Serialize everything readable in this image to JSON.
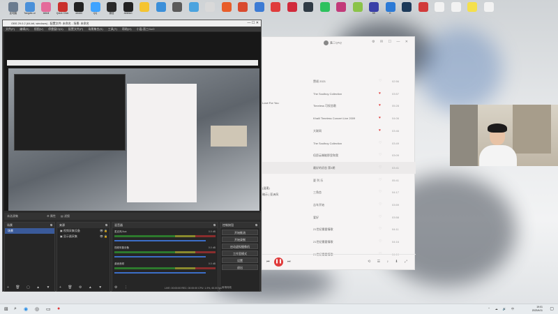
{
  "desktop_icons": [
    {
      "label": "此电脑",
      "color": "#6b7c8f"
    },
    {
      "label": "Tangdtc-ui",
      "color": "#4a90d9"
    },
    {
      "label": "bilibili",
      "color": "#e46b9a"
    },
    {
      "label": "Quick Click",
      "color": "#c9302c"
    },
    {
      "label": "obs64",
      "color": "#222222"
    },
    {
      "label": "QQ",
      "color": "#3ea3ff"
    },
    {
      "label": "微信",
      "color": "#2a2a2a"
    },
    {
      "label": "Ableton",
      "color": "#222222"
    },
    {
      "label": "",
      "color": "#f4c430"
    },
    {
      "label": "",
      "color": "#3b8fd9"
    },
    {
      "label": "",
      "color": "#5a5a5a"
    },
    {
      "label": "",
      "color": "#4aa3df"
    },
    {
      "label": "",
      "color": "#d9d9d9"
    },
    {
      "label": "",
      "color": "#e85d2a"
    },
    {
      "label": "",
      "color": "#d94a2f"
    },
    {
      "label": "",
      "color": "#3c7bd4"
    },
    {
      "label": "",
      "color": "#e03b3b"
    },
    {
      "label": "",
      "color": "#d12a3b"
    },
    {
      "label": "",
      "color": "#2f3a44"
    },
    {
      "label": "",
      "color": "#2dc15e"
    },
    {
      "label": "",
      "color": "#c23a7a"
    },
    {
      "label": "",
      "color": "#8bc34a"
    },
    {
      "label": "SE",
      "color": "#3a3fa8"
    },
    {
      "label": "K",
      "color": "#2c7ad6"
    },
    {
      "label": "",
      "color": "#1d3a5a"
    },
    {
      "label": "",
      "color": "#d13a3a"
    },
    {
      "label": "",
      "color": "#f2f2f2"
    },
    {
      "label": "",
      "color": "#f2f2f2"
    },
    {
      "label": "",
      "color": "#f4e04d"
    },
    {
      "label": "",
      "color": "#f2f2f2"
    }
  ],
  "obs": {
    "title": "OBS 29.0.2 (64-bit, windows) - 配置文件: 未命名 - 场景: 未命名",
    "menu": [
      "文件(F)",
      "编辑(E)",
      "视图(V)",
      "停靠窗口(D)",
      "配置文件(P)",
      "场景集合(S)",
      "工具(T)",
      "帮助(H)",
      "小盈-直三GoO"
    ],
    "scene_label": "未选源集",
    "scene_props": [
      "属性",
      "滤镜"
    ],
    "docks": {
      "scenes": {
        "title": "场景",
        "items": [
          "场景"
        ]
      },
      "sources": {
        "title": "来源",
        "items": [
          "视频采集设备",
          "显示器采集"
        ]
      },
      "mixer": {
        "title": "混音器",
        "items": [
          {
            "name": "麦克风/Aux",
            "db": "0.0 dB"
          },
          {
            "name": "视频采集设备",
            "db": "0.0 dB"
          },
          {
            "name": "桌面音频",
            "db": "0.0 dB"
          }
        ]
      },
      "transitions": {
        "title": "转场特效"
      },
      "controls": {
        "title": "控制按钮",
        "buttons": [
          "开始推流",
          "开始录制",
          "启动虚拟摄像机",
          "工作室模式",
          "设置",
          "退出"
        ]
      }
    },
    "status": "LIVE: 00:00:00   REC: 00:00:00   CPU: 1.9%, 60.00 fps"
  },
  "music": {
    "user": "鑫三QAQ",
    "side_text": [
      "Love For You",
      "(温柔)",
      "暗示 | 亚洲风"
    ],
    "tracks": [
      {
        "title": "赞颂 2021",
        "liked": false,
        "dur": "02:56"
      },
      {
        "title": "The Soulboy Collection",
        "liked": true,
        "dur": "03:57"
      },
      {
        "title": "Timeless 可叹恋歌",
        "liked": true,
        "dur": "05:28"
      },
      {
        "title": "Khalil Timeless Concert Live 2009",
        "liked": true,
        "dur": "04:06"
      },
      {
        "title": "大联网",
        "liked": true,
        "dur": "03:46"
      },
      {
        "title": "The Soulboy Collection",
        "liked": false,
        "dur": "03:49"
      },
      {
        "title": "但愿云端能那里和我",
        "liked": false,
        "dur": "03:09"
      },
      {
        "title": "最好的初恋 第3期",
        "liked": false,
        "dur": "03:41"
      },
      {
        "title": "夏 列 乐",
        "liked": false,
        "dur": "05:41"
      },
      {
        "title": "三角恋",
        "liked": false,
        "dur": "04:17"
      },
      {
        "title": "吉车开始",
        "liked": false,
        "dur": "03:59"
      },
      {
        "title": "爱好",
        "liked": false,
        "dur": "03:58"
      },
      {
        "title": "21世纪需要情歌",
        "liked": false,
        "dur": "04:11"
      },
      {
        "title": "21世纪需要情歌",
        "liked": false,
        "dur": "04:16"
      },
      {
        "title": "21世纪需要情歌",
        "liked": false,
        "dur": "04:19"
      }
    ]
  },
  "taskbar": {
    "time": "19:01",
    "date": "2023/4/11"
  }
}
